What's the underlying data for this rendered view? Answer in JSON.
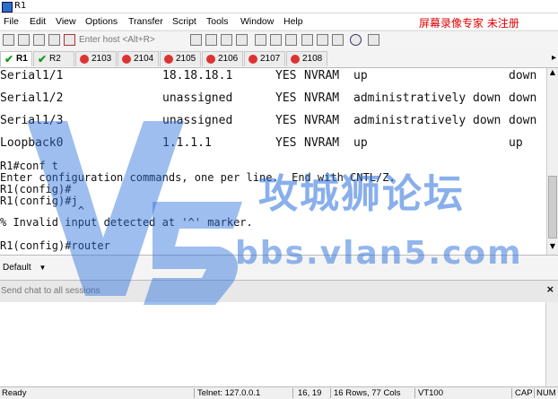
{
  "window": {
    "title": "R1"
  },
  "menu": [
    "File",
    "Edit",
    "View",
    "Options",
    "Transfer",
    "Script",
    "Tools",
    "Window",
    "Help"
  ],
  "menu_watermark": "屏幕录像专家 未注册",
  "toolbar": {
    "host_placeholder": "Enter host <Alt+R>"
  },
  "tabs": [
    {
      "label": "R1",
      "status": "connected",
      "active": true
    },
    {
      "label": "R2",
      "status": "connected",
      "active": false
    },
    {
      "label": "2103",
      "status": "disconnected",
      "active": false
    },
    {
      "label": "2104",
      "status": "disconnected",
      "active": false
    },
    {
      "label": "2105",
      "status": "disconnected",
      "active": false
    },
    {
      "label": "2106",
      "status": "disconnected",
      "active": false
    },
    {
      "label": "2107",
      "status": "disconnected",
      "active": false
    },
    {
      "label": "2108",
      "status": "disconnected",
      "active": false
    }
  ],
  "interfaces": [
    {
      "name": "Serial1/1",
      "ip": "18.18.18.1",
      "ok": "YES",
      "method": "NVRAM",
      "status": "up",
      "protocol": "down"
    },
    {
      "name": "Serial1/2",
      "ip": "unassigned",
      "ok": "YES",
      "method": "NVRAM",
      "status": "administratively down",
      "protocol": "down"
    },
    {
      "name": "Serial1/3",
      "ip": "unassigned",
      "ok": "YES",
      "method": "NVRAM",
      "status": "administratively down",
      "protocol": "down"
    },
    {
      "name": "Loopback0",
      "ip": "1.1.1.1",
      "ok": "YES",
      "method": "NVRAM",
      "status": "up",
      "protocol": "up"
    }
  ],
  "terminal_lines": [
    "R1#conf t",
    "Enter configuration commands, one per line.  End with CNTL/Z.",
    "R1(config)#",
    "R1(config)#j",
    "            ^",
    "% Invalid input detected at '^' marker.",
    "",
    "R1(config)#router"
  ],
  "command_bar": {
    "session_select": "Default"
  },
  "chat": {
    "placeholder": "Send chat to all sessions"
  },
  "statusbar": {
    "state": "Ready",
    "connection": "Telnet: 127.0.0.1",
    "cursor": "16, 19",
    "size": "16 Rows, 77 Cols",
    "emulation": "VT100",
    "caps": "CAP",
    "num": "NUM"
  },
  "watermark": {
    "title": "攻城狮论坛",
    "url": "bbs.vlan5.com"
  },
  "colors": {
    "watermark_blue": "#2a6edc",
    "error_red": "#d33333",
    "ok_green": "#1a9a1a"
  }
}
